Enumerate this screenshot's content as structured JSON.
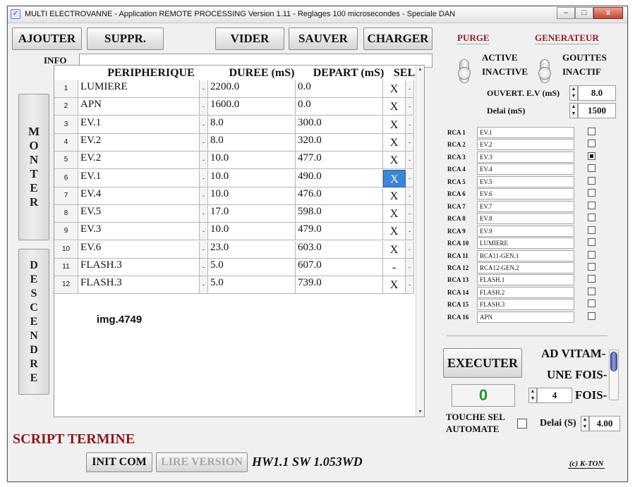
{
  "window": {
    "title": "MULTI ELECTROVANNE - Application REMOTE PROCESSING Version 1.11 - Reglages 100 microsecondes - Speciale DAN",
    "minimize": "–",
    "maximize": "□",
    "close": "x"
  },
  "toolbar": {
    "ajouter": "AJOUTER",
    "suppr": "SUPPR.",
    "vider": "VIDER",
    "sauver": "SAUVER",
    "charger": "CHARGER"
  },
  "info": {
    "label": "INFO",
    "value": ""
  },
  "side": {
    "monter": [
      "M",
      "O",
      "N",
      "T",
      "E",
      "R"
    ],
    "descendre": [
      "D",
      "E",
      "S",
      "C",
      "E",
      "N",
      "D",
      "R",
      "E"
    ]
  },
  "table": {
    "headers": [
      "PERIPHERIQUE",
      "DUREE (mS)",
      "DEPART (mS)",
      "SEL"
    ],
    "rows": [
      {
        "num": "1",
        "peripherique": "LUMIERE",
        "duree": "2200.0",
        "depart": "0.0",
        "sel": "X"
      },
      {
        "num": "2",
        "peripherique": "APN",
        "duree": "1600.0",
        "depart": "0.0",
        "sel": "X"
      },
      {
        "num": "3",
        "peripherique": "EV.1",
        "duree": "8.0",
        "depart": "300.0",
        "sel": "X"
      },
      {
        "num": "4",
        "peripherique": "EV.2",
        "duree": "8.0",
        "depart": "320.0",
        "sel": "X"
      },
      {
        "num": "5",
        "peripherique": "EV.2",
        "duree": "10.0",
        "depart": "477.0",
        "sel": "X"
      },
      {
        "num": "6",
        "peripherique": "EV.1",
        "duree": "10.0",
        "depart": "490.0",
        "sel": "X"
      },
      {
        "num": "7",
        "peripherique": "EV.4",
        "duree": "10.0",
        "depart": "476.0",
        "sel": "X"
      },
      {
        "num": "8",
        "peripherique": "EV.5",
        "duree": "17.0",
        "depart": "598.0",
        "sel": "X"
      },
      {
        "num": "9",
        "peripherique": "EV.3",
        "duree": "10.0",
        "depart": "479.0",
        "sel": "X"
      },
      {
        "num": "10",
        "peripherique": "EV.6",
        "duree": "23.0",
        "depart": "603.0",
        "sel": "X"
      },
      {
        "num": "11",
        "peripherique": "FLASH.3",
        "duree": "5.0",
        "depart": "607.0",
        "sel": "-"
      },
      {
        "num": "12",
        "peripherique": "FLASH.3",
        "duree": "5.0",
        "depart": "739.0",
        "sel": "X"
      }
    ],
    "dropdown_glyph": "-",
    "scroll_up": "▲",
    "scroll_down": "▼"
  },
  "watermark": "img.4749",
  "status": {
    "script": "SCRIPT TERMINE",
    "init_com": "INIT COM",
    "lire_version": "LIRE VERSION",
    "version": "HW1.1 SW 1.053WD",
    "copyright": "(c) K-TON"
  },
  "right": {
    "purge": "PURGE",
    "generateur": "GENERATEUR",
    "active": "ACTIVE",
    "inactive": "INACTIVE",
    "gouttes": "GOUTTES",
    "inactif": "INACTIF",
    "ouvert_label": "OUVERT. E.V (mS)",
    "ouvert_value": "8.0",
    "delai_label": "Delai (mS)",
    "delai_value": "1500",
    "rca": [
      {
        "label": "RCA 1",
        "value": "EV.1",
        "checked": false
      },
      {
        "label": "RCA 2",
        "value": "EV.2",
        "checked": false
      },
      {
        "label": "RCA 3",
        "value": "EV.3",
        "checked": true
      },
      {
        "label": "RCA 4",
        "value": "EV.4",
        "checked": false
      },
      {
        "label": "RCA 5",
        "value": "EV.5",
        "checked": false
      },
      {
        "label": "RCA 6",
        "value": "EV.6",
        "checked": false
      },
      {
        "label": "RCA 7",
        "value": "EV.7",
        "checked": false
      },
      {
        "label": "RCA 8",
        "value": "EV.8",
        "checked": false
      },
      {
        "label": "RCA 9",
        "value": "EV.9",
        "checked": false
      },
      {
        "label": "RCA 10",
        "value": "LUMIERE",
        "checked": false
      },
      {
        "label": "RCA 11",
        "value": "RCA11-GEN.1",
        "checked": false
      },
      {
        "label": "RCA 12",
        "value": "RCA12-GEN.2",
        "checked": false
      },
      {
        "label": "RCA 13",
        "value": "FLASH.1",
        "checked": false
      },
      {
        "label": "RCA 14",
        "value": "FLASH.2",
        "checked": false
      },
      {
        "label": "RCA 15",
        "value": "FLASH.3",
        "checked": false
      },
      {
        "label": "RCA 16",
        "value": "APN",
        "checked": false
      }
    ],
    "executer": "EXECUTER",
    "ad_vitam": "AD VITAM-",
    "une_fois": "UNE FOIS-",
    "counter": "0",
    "fois_value": "4",
    "fois_label": "FOIS-",
    "touche_sel": "TOUCHE SEL",
    "automate": "AUTOMATE",
    "delai_s_label": "Delai (S)",
    "delai_s_value": "4.00"
  },
  "colors": {
    "accent_red": "#8b1a1a",
    "counter_green": "#1a9a2a",
    "selected_cell": "#3c86d8"
  }
}
